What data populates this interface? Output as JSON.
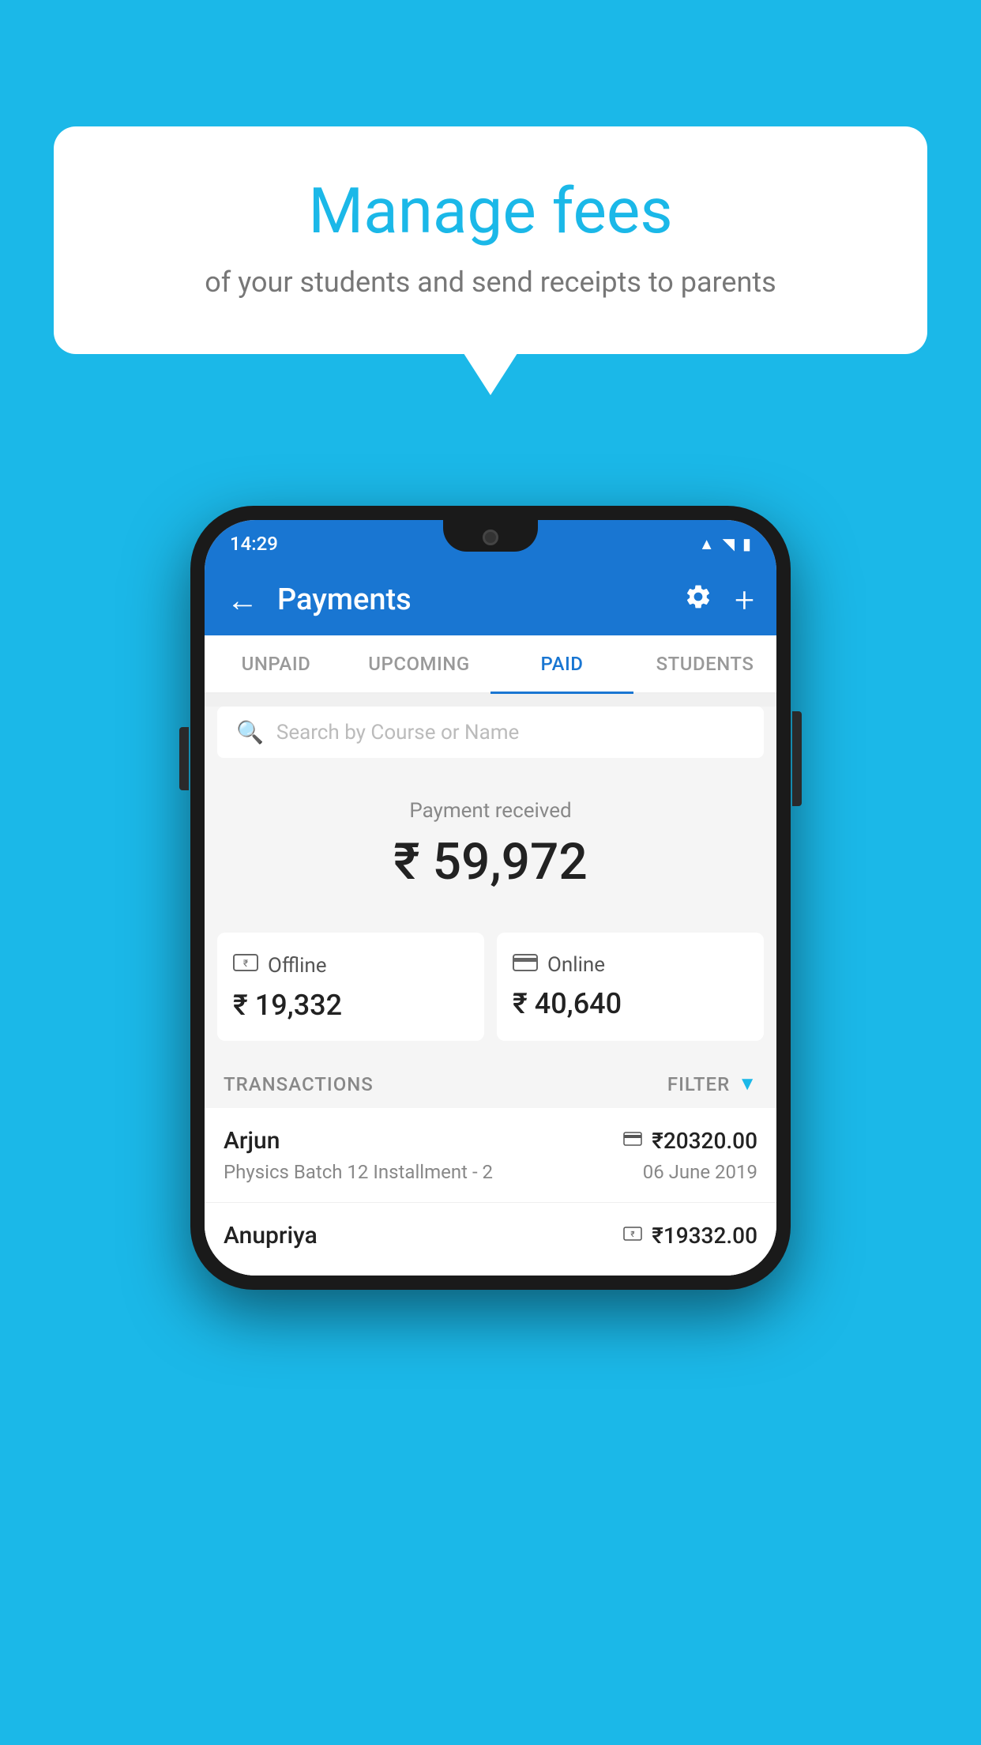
{
  "background_color": "#1BB8E8",
  "speech_bubble": {
    "title": "Manage fees",
    "subtitle": "of your students and send receipts to parents"
  },
  "phone": {
    "status_bar": {
      "time": "14:29",
      "wifi": "▲",
      "signal": "▲",
      "battery": "▮"
    },
    "app_bar": {
      "title": "Payments",
      "back_icon": "←",
      "settings_icon": "⚙",
      "add_icon": "+"
    },
    "tabs": [
      {
        "label": "UNPAID",
        "active": false
      },
      {
        "label": "UPCOMING",
        "active": false
      },
      {
        "label": "PAID",
        "active": true
      },
      {
        "label": "STUDENTS",
        "active": false
      }
    ],
    "search": {
      "placeholder": "Search by Course or Name"
    },
    "payment_summary": {
      "label": "Payment received",
      "total": "₹ 59,972",
      "offline": {
        "type": "Offline",
        "amount": "₹ 19,332"
      },
      "online": {
        "type": "Online",
        "amount": "₹ 40,640"
      }
    },
    "transactions": {
      "label": "TRANSACTIONS",
      "filter_label": "FILTER",
      "items": [
        {
          "name": "Arjun",
          "course": "Physics Batch 12 Installment - 2",
          "amount": "₹20320.00",
          "date": "06 June 2019",
          "payment_method": "online"
        },
        {
          "name": "Anupriya",
          "course": "",
          "amount": "₹19332.00",
          "date": "",
          "payment_method": "offline"
        }
      ]
    }
  }
}
